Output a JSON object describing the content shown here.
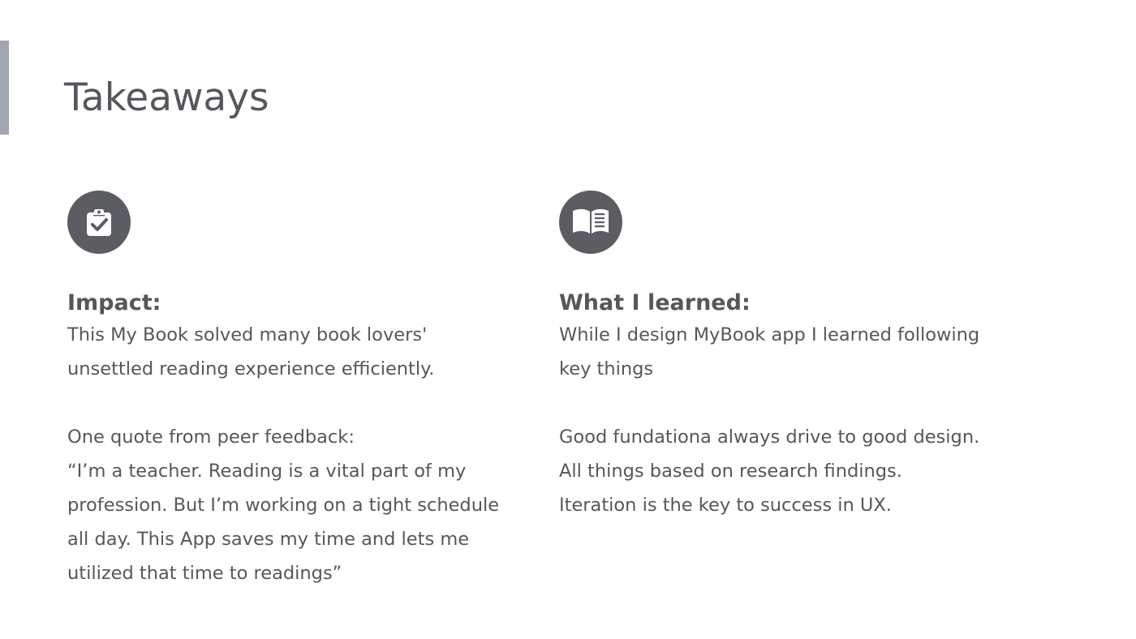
{
  "slide": {
    "title": "Takeaways"
  },
  "impact": {
    "icon": "clipboard-check-icon",
    "heading": "Impact:",
    "intro_lines": [
      "This My Book solved many book lovers'",
      "unsettled reading experience efficiently."
    ],
    "quote_lines": [
      "One quote from peer feedback:",
      "“I’m a teacher. Reading is a vital part of my",
      "profession. But I’m working on a tight schedule",
      "all day. This App saves my time and lets me",
      "utilized that time to readings”"
    ]
  },
  "learned": {
    "icon": "open-book-icon",
    "heading": "What I learned:",
    "intro_lines": [
      "While I design MyBook app I learned following",
      "key things"
    ],
    "point_lines": [
      "Good fundationa always drive to good design.",
      "All things based on research findings.",
      "Iteration is the key to success in UX."
    ]
  },
  "colors": {
    "text": "#55575c",
    "icon_circle": "#5b5d63",
    "accent_bar": "#a1a6ae",
    "background": "#ffffff"
  }
}
